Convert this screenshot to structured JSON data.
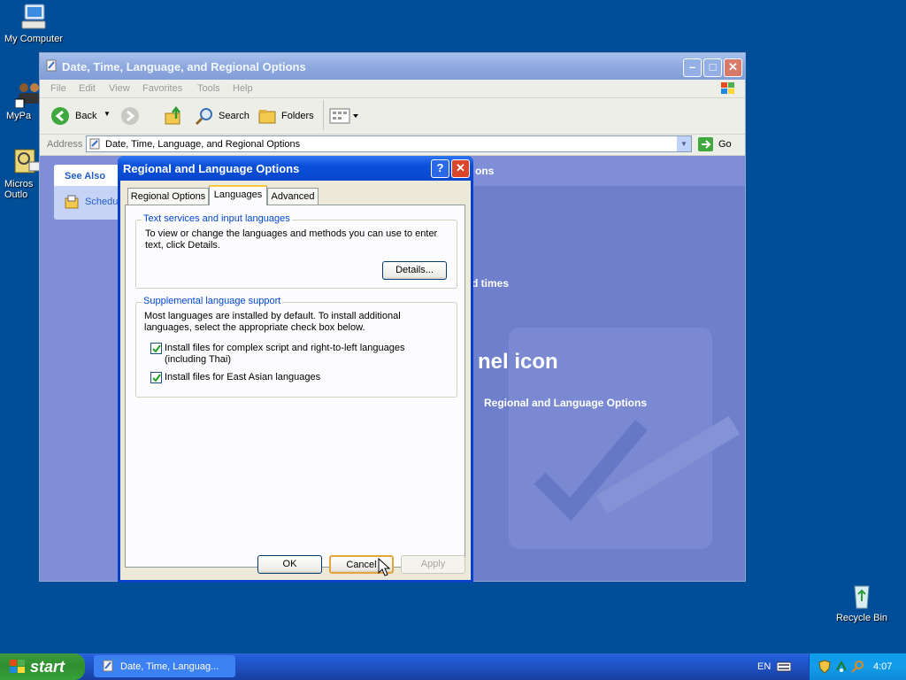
{
  "desktop": {
    "icons": [
      {
        "label": "My Computer",
        "name": "my-computer-icon"
      },
      {
        "label": "MyPa",
        "name": "mypa-shortcut-icon"
      },
      {
        "label": "Micros Outlo",
        "name": "microsoft-outlook-icon"
      },
      {
        "label": "Recycle Bin",
        "name": "recycle-bin-icon"
      }
    ]
  },
  "explorer": {
    "title": "Date, Time, Language, and Regional Options",
    "menu": [
      "File",
      "Edit",
      "View",
      "Favorites",
      "Tools",
      "Help"
    ],
    "toolbar": {
      "back": "Back",
      "search": "Search",
      "folders": "Folders"
    },
    "address": {
      "label": "Address",
      "value": "Date, Time, Language, and Regional Options",
      "go": "Go"
    },
    "sidebar": {
      "see_also": "See Also",
      "item": "Schedu"
    },
    "content_fragments": {
      "heading": "ons",
      "task": "d times",
      "panel_icon": "nel icon",
      "link": "Regional and Language Options"
    }
  },
  "dialog": {
    "title": "Regional and Language Options",
    "tabs": [
      "Regional Options",
      "Languages",
      "Advanced"
    ],
    "active_tab": "Languages",
    "group1": {
      "title": "Text services and input languages",
      "text": "To view or change the languages and methods you can use to enter text, click Details.",
      "button": "Details..."
    },
    "group2": {
      "title": "Supplemental language support",
      "text": "Most languages are installed by default. To install additional languages, select the appropriate check box below.",
      "checkbox1": "Install files for complex script and right-to-left languages (including Thai)",
      "checkbox2": "Install files for East Asian languages",
      "checkbox1_checked": true,
      "checkbox2_checked": true
    },
    "buttons": {
      "ok": "OK",
      "cancel": "Cancel",
      "apply": "Apply"
    }
  },
  "taskbar": {
    "start": "start",
    "task": "Date, Time, Languag...",
    "lang": "EN",
    "clock": "4:07"
  },
  "colors": {
    "desktop": "#004e98",
    "dialog_title": "#0a4fd8",
    "group_title": "#0046d5"
  }
}
